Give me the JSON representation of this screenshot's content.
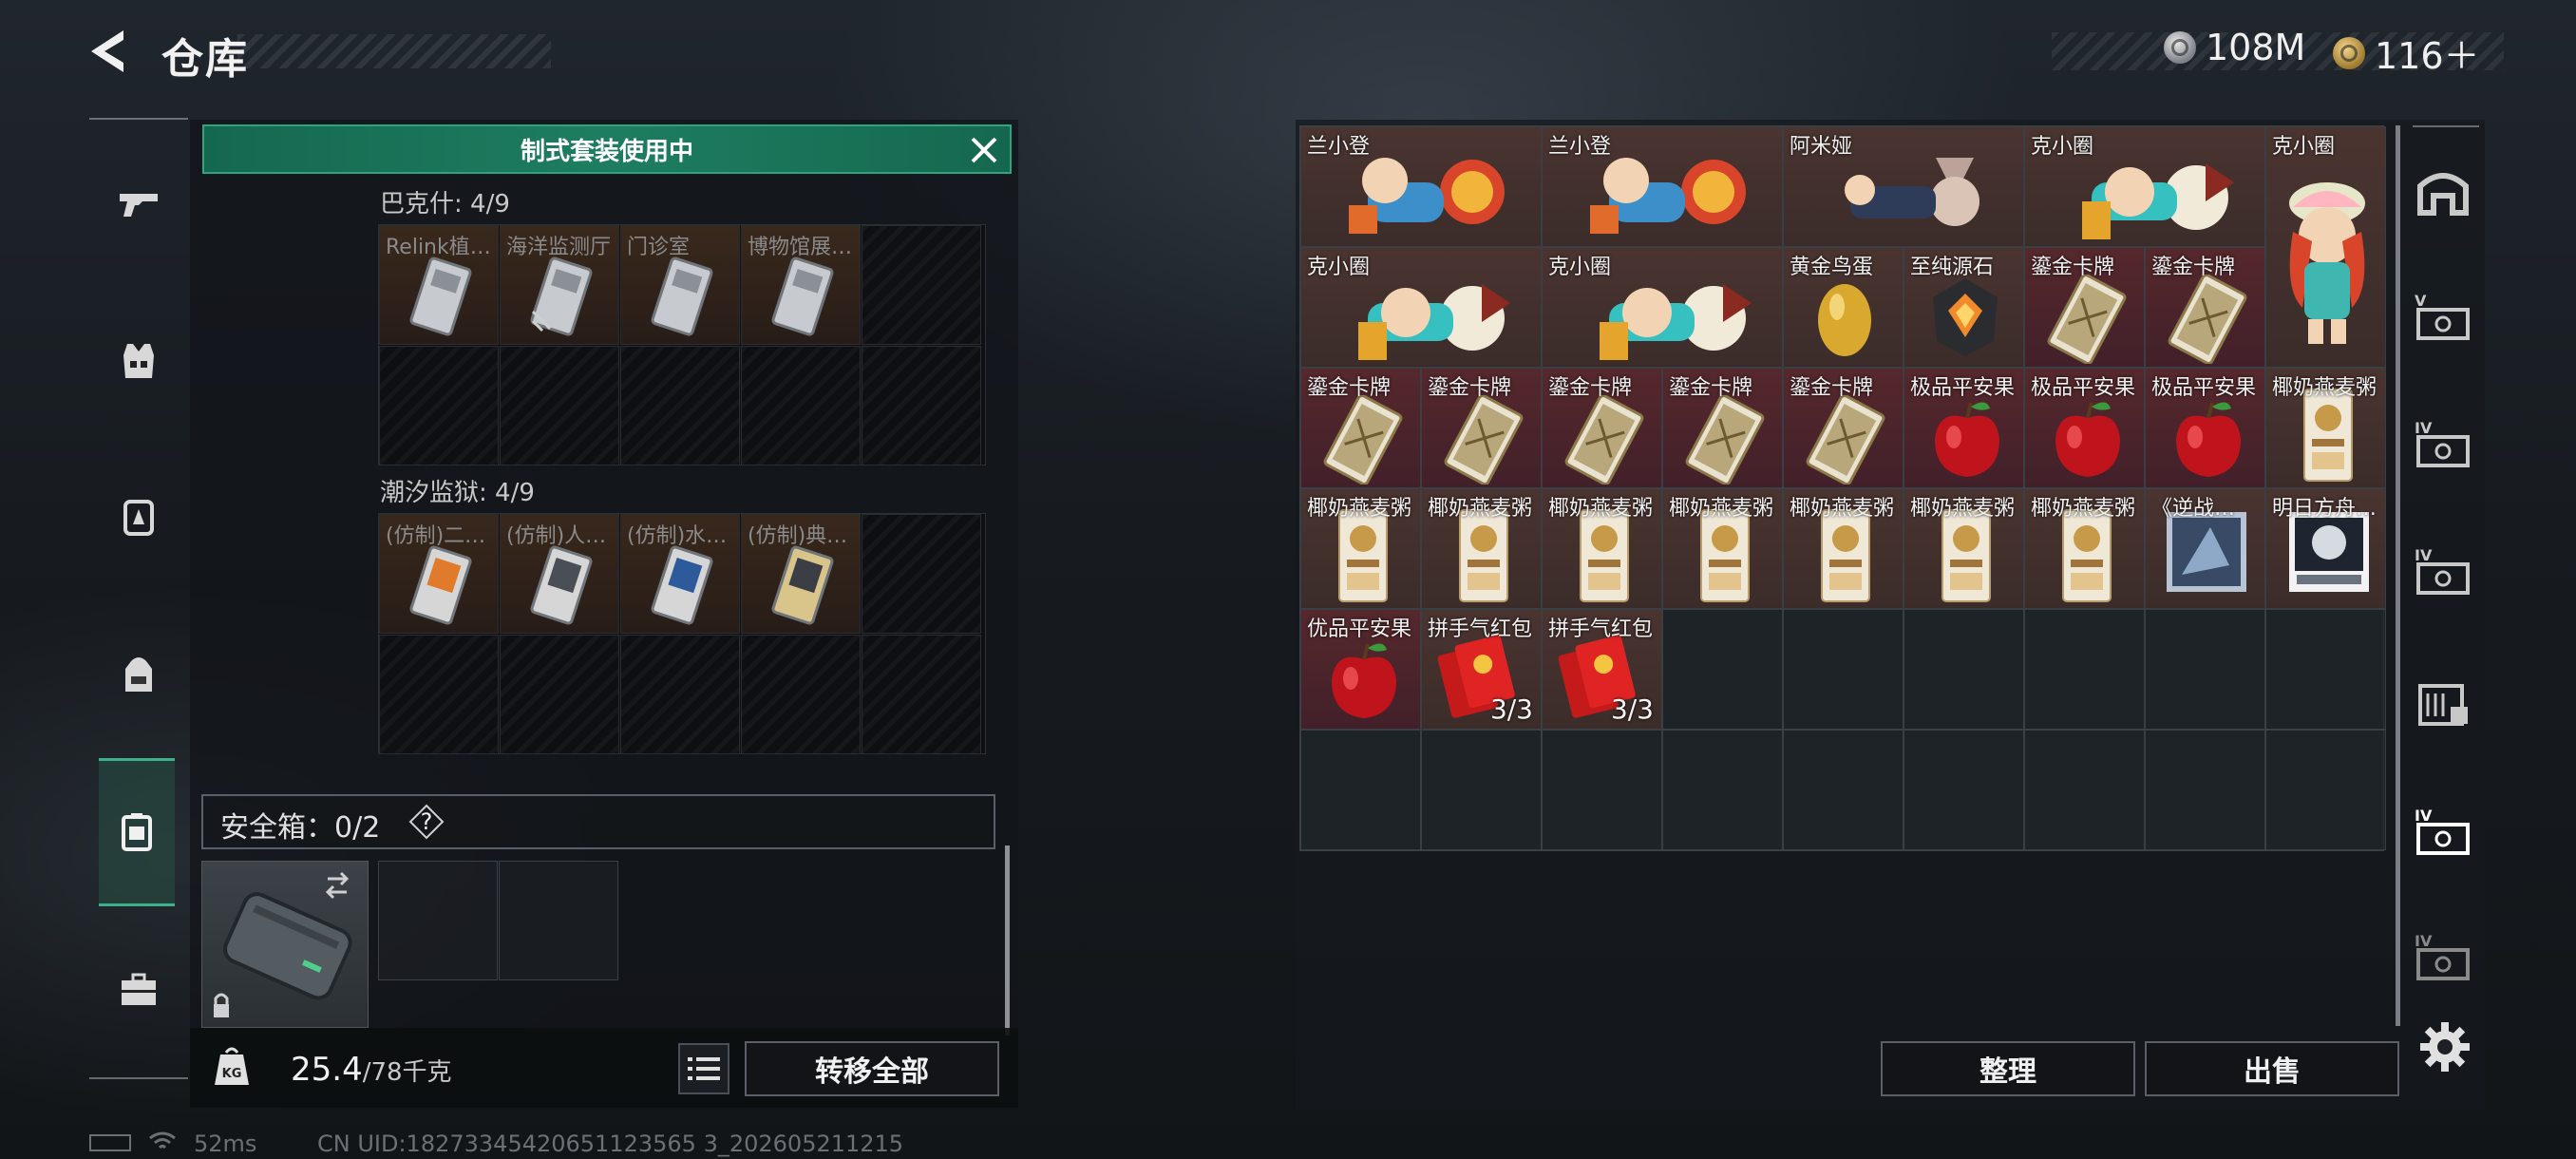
{
  "header": {
    "title": "仓库",
    "currency": [
      {
        "icon": "silver-coin-icon",
        "value": "108M"
      },
      {
        "icon": "gold-coin-icon",
        "value": "116＋"
      }
    ]
  },
  "left_nav": [
    "pistol-icon",
    "vest-icon",
    "backpack-rig-icon",
    "backpack-icon",
    "container-icon",
    "toolbox-icon"
  ],
  "left_panel": {
    "banner": "制式套装使用中",
    "sets": [
      {
        "title": "巴克什: 4/9",
        "items": [
          "Relink植…",
          "海洋监测厅",
          "门诊室",
          "博物馆展…"
        ]
      },
      {
        "title": "潮汐监狱: 4/9",
        "items": [
          "(仿制)二…",
          "(仿制)人…",
          "(仿制)水…",
          "(仿制)典…"
        ]
      }
    ],
    "safe_box": {
      "label": "安全箱：0/2",
      "help": "?"
    },
    "weight": {
      "current": "25.4",
      "max": "/78千克"
    },
    "transfer_all": "转移全部"
  },
  "stash": {
    "items": [
      {
        "name": "兰小登"
      },
      {
        "name": "兰小登"
      },
      {
        "name": "阿米娅"
      },
      {
        "name": "克小圈"
      },
      {
        "name": "克小圈"
      },
      {
        "name": "克小圈"
      },
      {
        "name": "克小圈"
      },
      {
        "name": "黄金鸟蛋"
      },
      {
        "name": "至纯源石"
      },
      {
        "name": "鎏金卡牌"
      },
      {
        "name": "鎏金卡牌"
      },
      {
        "name": "鎏金卡牌"
      },
      {
        "name": "鎏金卡牌"
      },
      {
        "name": "鎏金卡牌"
      },
      {
        "name": "鎏金卡牌"
      },
      {
        "name": "鎏金卡牌"
      },
      {
        "name": "极品平安果"
      },
      {
        "name": "极品平安果"
      },
      {
        "name": "极品平安果"
      },
      {
        "name": "椰奶燕麦粥"
      },
      {
        "name": "椰奶燕麦粥"
      },
      {
        "name": "椰奶燕麦粥"
      },
      {
        "name": "椰奶燕麦粥"
      },
      {
        "name": "椰奶燕麦粥"
      },
      {
        "name": "椰奶燕麦粥"
      },
      {
        "name": "椰奶燕麦粥"
      },
      {
        "name": "椰奶燕麦粥"
      },
      {
        "name": "《逆战…"
      },
      {
        "name": "明日方舟…"
      },
      {
        "name": "优品平安果"
      },
      {
        "name": "拼手气红包",
        "count": "3/3"
      },
      {
        "name": "拼手气红包",
        "count": "3/3"
      }
    ],
    "sort": "整理",
    "sell": "出售"
  },
  "right_tabs": [
    "home-icon",
    "tier-v-case-icon",
    "tier-iv-case-a-icon",
    "tier-iv-case-b-icon",
    "ticket-box-icon",
    "tier-iv-case-c-icon",
    "tier-iv-case-d-icon"
  ],
  "status": {
    "ping": "52ms",
    "uid": "CN UID:18273345420651123565 3_202605211215"
  }
}
